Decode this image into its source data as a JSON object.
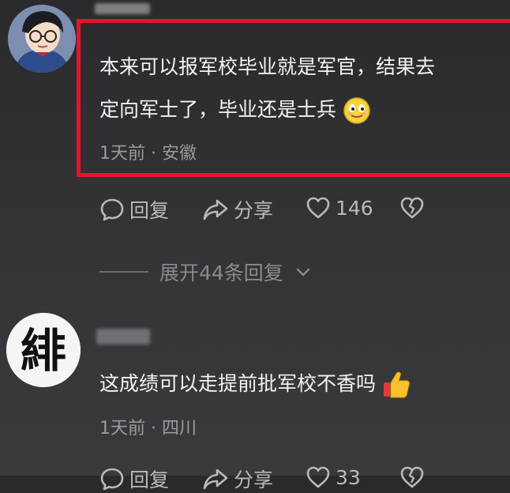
{
  "comments": [
    {
      "text_line1": "本来可以报军校毕业就是军官，结果去",
      "text_line2": "定向军士了，毕业还是士兵",
      "emoji": "smile-emoji",
      "time": "1天前",
      "separator": "·",
      "location": "安徽",
      "actions": {
        "reply": "回复",
        "share": "分享",
        "likes": "146"
      },
      "expand_replies": "展开44条回复"
    },
    {
      "avatar_glyph": "緋",
      "text": "这成绩可以走提前批军校不香吗",
      "emoji": "thumbs-up-emoji",
      "time": "1天前",
      "separator": "·",
      "location": "四川",
      "actions": {
        "reply": "回复",
        "share": "分享",
        "likes": "33"
      }
    }
  ],
  "colors": {
    "highlight_border": "#e8132b",
    "background": "#303033",
    "meta_text": "#9a9a9f"
  }
}
